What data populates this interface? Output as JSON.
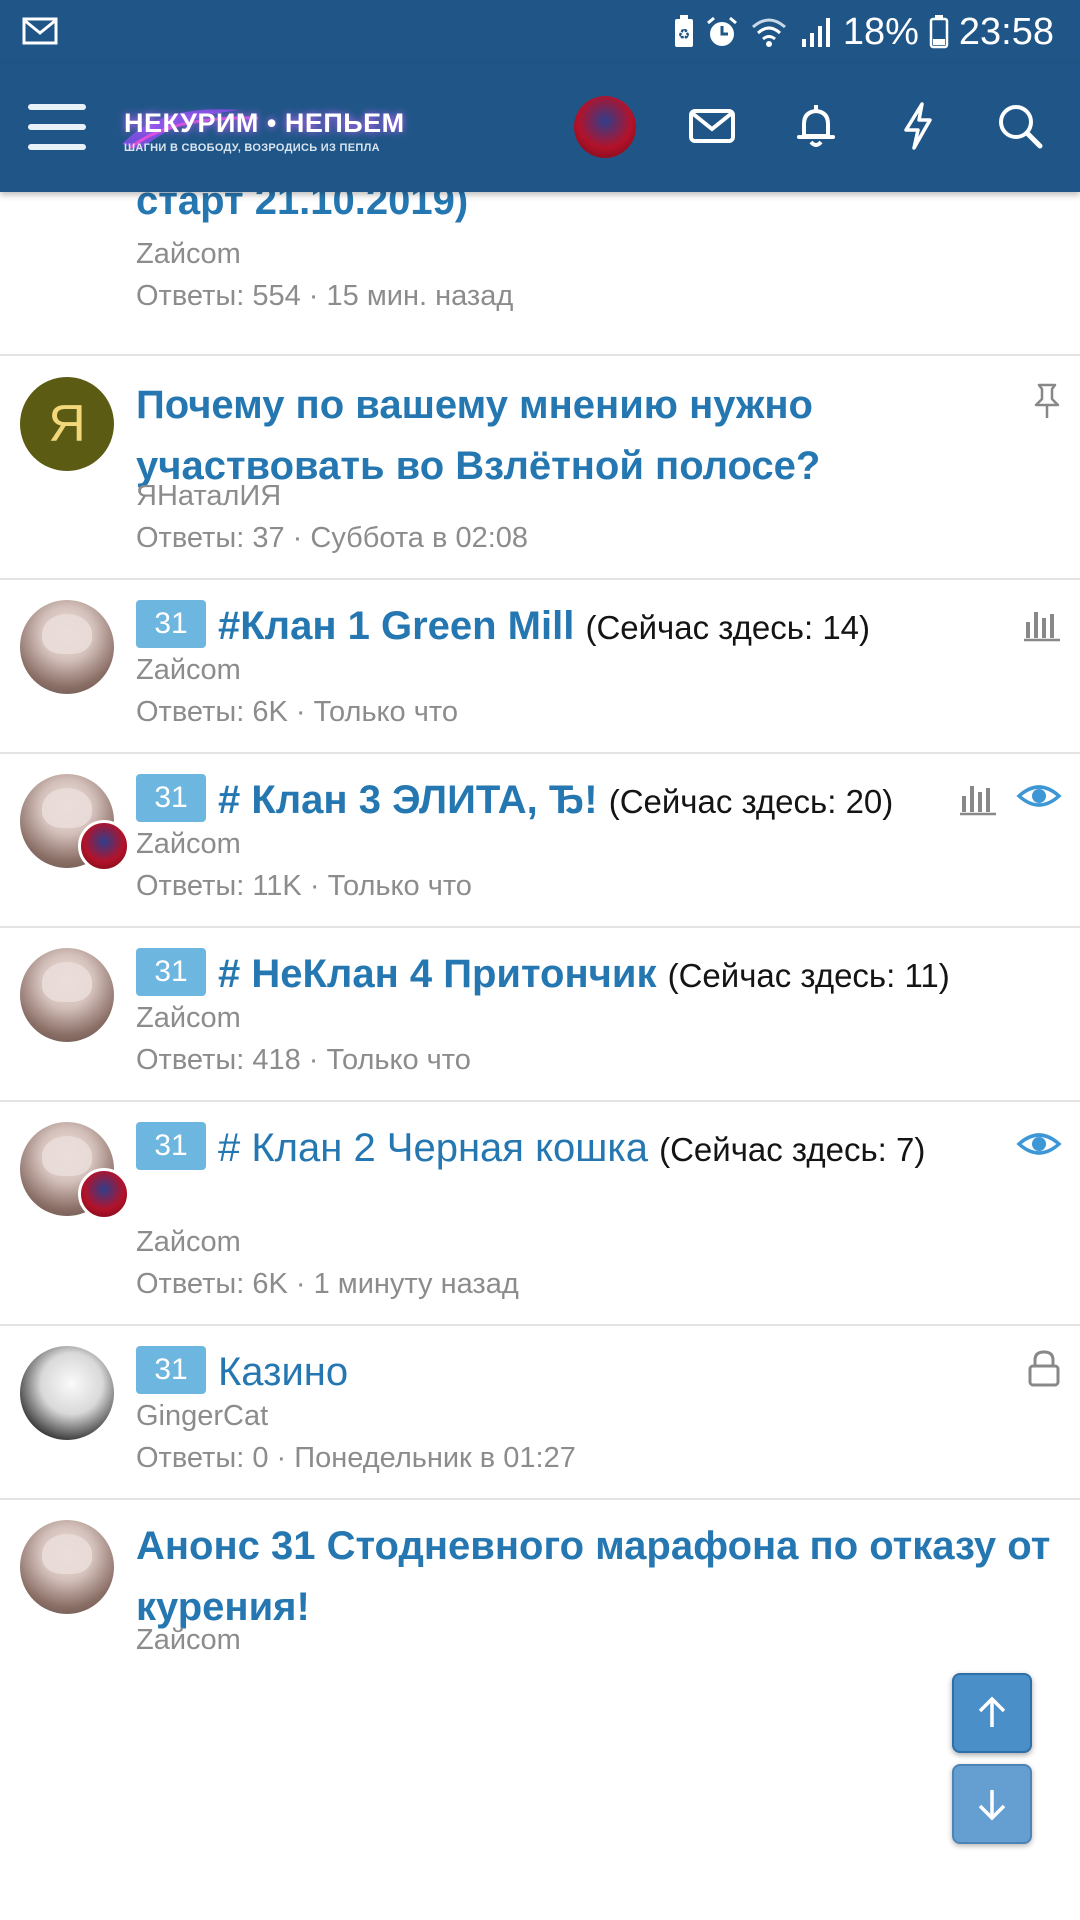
{
  "status_bar": {
    "battery_percent": "18%",
    "time": "23:58",
    "icons": [
      "mail-icon",
      "battery-saver-icon",
      "alarm-icon",
      "wifi-icon",
      "signal-icon",
      "battery-icon"
    ]
  },
  "header": {
    "logo_main": "НЕКУРИМ • НЕПЬЕМ",
    "logo_sub": "ШАГНИ В СВОБОДУ, ВОЗРОДИСЬ ИЗ ПЕПЛА",
    "icons": [
      "menu-icon",
      "avatar",
      "mail-icon",
      "bell-icon",
      "bolt-icon",
      "search-icon"
    ]
  },
  "colors": {
    "header_bg": "#1f5687",
    "link_blue": "#2577b1",
    "prefix_bg": "#6cb6e0",
    "meta_gray": "#8c8c8c"
  },
  "threads": [
    {
      "title": "старт 21.10.2019)",
      "author": "Zайcom",
      "replies": "Ответы: 554",
      "last": "15 мин. назад"
    },
    {
      "avatar_letter": "Я",
      "title": "Почему по вашему мнению нужно участвовать во Взлётной полосе?",
      "author": "ЯНаталИЯ",
      "replies": "Ответы: 37",
      "last": "Суббота в 02:08",
      "status_icon": "pin-icon"
    },
    {
      "prefix": "31",
      "title": "#Клан 1 Green Mill",
      "here": "(Сейчас здесь: 14)",
      "author": "Zайcom",
      "replies": "Ответы: 6K",
      "last": "Только что",
      "status_icon": "poll-icon"
    },
    {
      "prefix": "31",
      "title": "# Клан 3 ЭЛИТА, Ђ!",
      "here": "(Сейчас здесь: 20)",
      "author": "Zайcom",
      "replies": "Ответы: 11K",
      "last": "Только что",
      "status_icon": "poll-icon"
    },
    {
      "prefix": "31",
      "title": "# НеКлан 4 Притончик",
      "here": "(Сейчас здесь: 11)",
      "author": "Zайcom",
      "replies": "Ответы: 418",
      "last": "Только что"
    },
    {
      "prefix": "31",
      "title": "# Клан 2 Черная кошка",
      "here": "(Сейчас здесь: 7)",
      "author": "Zайcom",
      "replies": "Ответы: 6K",
      "last": "1 минуту назад"
    },
    {
      "prefix": "31",
      "title": "Казино",
      "author": "GingerCat",
      "replies": "Ответы: 0",
      "last": "Понедельник в 01:27",
      "status_icon": "lock-icon"
    },
    {
      "title": "Анонс 31 Стодневного марафона по отказу от курения!",
      "author": "Zайcom"
    }
  ],
  "scroll_buttons": [
    "scroll-up-icon",
    "scroll-down-icon"
  ]
}
